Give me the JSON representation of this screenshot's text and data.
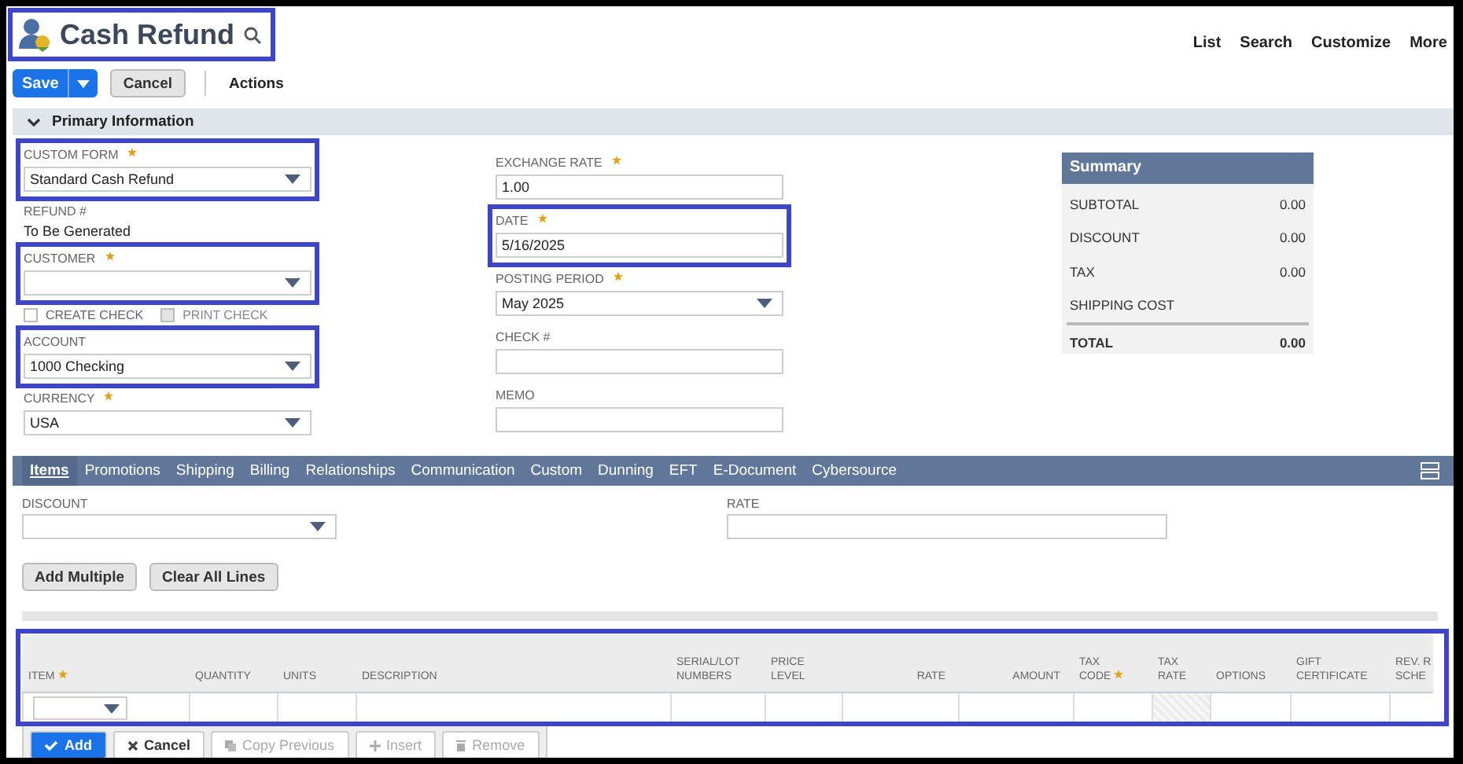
{
  "page": {
    "title": "Cash Refund",
    "highlighted": true
  },
  "nav_links": [
    "List",
    "Search",
    "Customize",
    "More"
  ],
  "toolbar": {
    "save": "Save",
    "cancel": "Cancel",
    "actions": "Actions"
  },
  "section": {
    "title": "Primary Information",
    "expanded": true
  },
  "left_fields": [
    {
      "kind": "select",
      "label": "CUSTOM FORM",
      "required": true,
      "value": "Standard Cash Refund",
      "highlighted": true
    },
    {
      "kind": "static",
      "label": "REFUND #",
      "required": false,
      "value": "To Be Generated",
      "highlighted": false
    },
    {
      "kind": "select",
      "label": "CUSTOMER",
      "required": true,
      "highlighted": true
    },
    {
      "kind": "checkboxes",
      "options": [
        {
          "label": "CREATE CHECK",
          "checked": false,
          "disabled": false
        },
        {
          "label": "PRINT CHECK",
          "checked": false,
          "disabled": true
        }
      ],
      "highlighted": false
    },
    {
      "kind": "select",
      "label": "ACCOUNT",
      "required": false,
      "value": "1000 Checking",
      "highlighted": true
    },
    {
      "kind": "select",
      "label": "CURRENCY",
      "required": true,
      "value": "USA",
      "highlighted": false
    }
  ],
  "middle_fields": [
    {
      "kind": "text",
      "label": "EXCHANGE RATE",
      "required": true,
      "value": "1.00",
      "highlighted": false
    },
    {
      "kind": "text",
      "label": "DATE",
      "required": true,
      "value": "5/16/2025",
      "highlighted": true
    },
    {
      "kind": "select",
      "label": "POSTING PERIOD",
      "required": true,
      "value": "May 2025",
      "highlighted": false
    },
    {
      "kind": "text",
      "label": "CHECK #",
      "required": false,
      "highlighted": false
    },
    {
      "kind": "text",
      "label": "MEMO",
      "required": false,
      "highlighted": false
    }
  ],
  "summary": {
    "title": "Summary",
    "rows": [
      {
        "label": "SUBTOTAL",
        "value": "0.00",
        "total": false
      },
      {
        "label": "DISCOUNT",
        "value": "0.00",
        "total": false
      },
      {
        "label": "TAX",
        "value": "0.00",
        "total": false
      },
      {
        "label": "SHIPPING COST",
        "total": false
      },
      {
        "label": "TOTAL",
        "value": "0.00",
        "total": true
      }
    ]
  },
  "tabs": [
    {
      "label": "Items",
      "selected": true
    },
    {
      "label": "Promotions",
      "selected": false
    },
    {
      "label": "Shipping",
      "selected": false
    },
    {
      "label": "Billing",
      "selected": false
    },
    {
      "label": "Relationships",
      "selected": false
    },
    {
      "label": "Communication",
      "selected": false
    },
    {
      "label": "Custom",
      "selected": false
    },
    {
      "label": "Dunning",
      "selected": false
    },
    {
      "label": "EFT",
      "selected": false
    },
    {
      "label": "E-Document",
      "selected": false
    },
    {
      "label": "Cybersource",
      "selected": false
    }
  ],
  "items_fields": {
    "discount": {
      "label": "DISCOUNT"
    },
    "rate": {
      "label": "RATE"
    }
  },
  "items_buttons": [
    "Add Multiple",
    "Clear All Lines"
  ],
  "items_table": {
    "highlighted": true,
    "columns": [
      {
        "label": "ITEM",
        "required": true,
        "kind": "select"
      },
      {
        "label": "QUANTITY",
        "kind": "text"
      },
      {
        "label": "UNITS",
        "kind": "text"
      },
      {
        "label": "DESCRIPTION",
        "kind": "text"
      },
      {
        "label": "SERIAL/LOT\nNUMBERS",
        "kind": "text"
      },
      {
        "label": "PRICE\nLEVEL",
        "kind": "text"
      },
      {
        "label": "RATE",
        "kind": "number"
      },
      {
        "label": "AMOUNT",
        "kind": "number"
      },
      {
        "label": "TAX\nCODE",
        "required": true,
        "kind": "text"
      },
      {
        "label": "TAX\nRATE",
        "kind": "readonly"
      },
      {
        "label": "OPTIONS",
        "kind": "text"
      },
      {
        "label": "GIFT\nCERTIFICATE",
        "kind": "text"
      },
      {
        "label": "REV. R\nSCHE",
        "kind": "text"
      }
    ]
  },
  "line_buttons": [
    {
      "label": "Add",
      "kind": "primary",
      "disabled": false
    },
    {
      "label": "Cancel",
      "kind": "cancel",
      "disabled": false
    },
    {
      "label": "Copy Previous",
      "kind": "copy",
      "disabled": true
    },
    {
      "label": "Insert",
      "kind": "insert",
      "disabled": true
    },
    {
      "label": "Remove",
      "kind": "remove",
      "disabled": true
    }
  ]
}
